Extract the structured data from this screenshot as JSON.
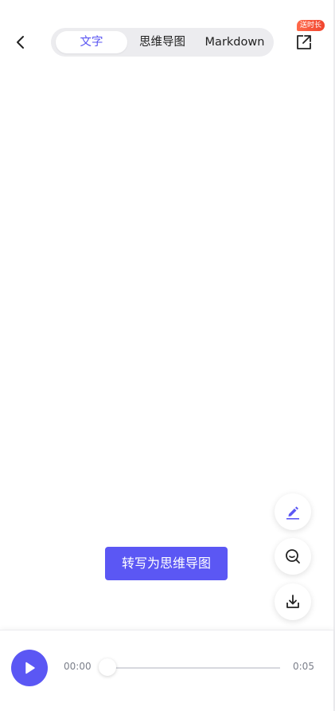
{
  "header": {
    "tabs": [
      {
        "label": "文字",
        "active": true
      },
      {
        "label": "思维导图",
        "active": false
      },
      {
        "label": "Markdown",
        "active": false
      }
    ],
    "badge": "送时长"
  },
  "actions": {
    "convert_label": "转写为思维导图"
  },
  "player": {
    "current_time": "00:00",
    "total_time": "0:05",
    "progress": 0
  },
  "colors": {
    "accent": "#5b57f4",
    "badge": "#f0452f",
    "tab_bg": "#ececef"
  },
  "icons": {
    "back": "chevron-left-icon",
    "share": "share-external-icon",
    "edit": "pencil-icon",
    "search": "search-icon",
    "download": "download-icon",
    "play": "play-icon"
  }
}
